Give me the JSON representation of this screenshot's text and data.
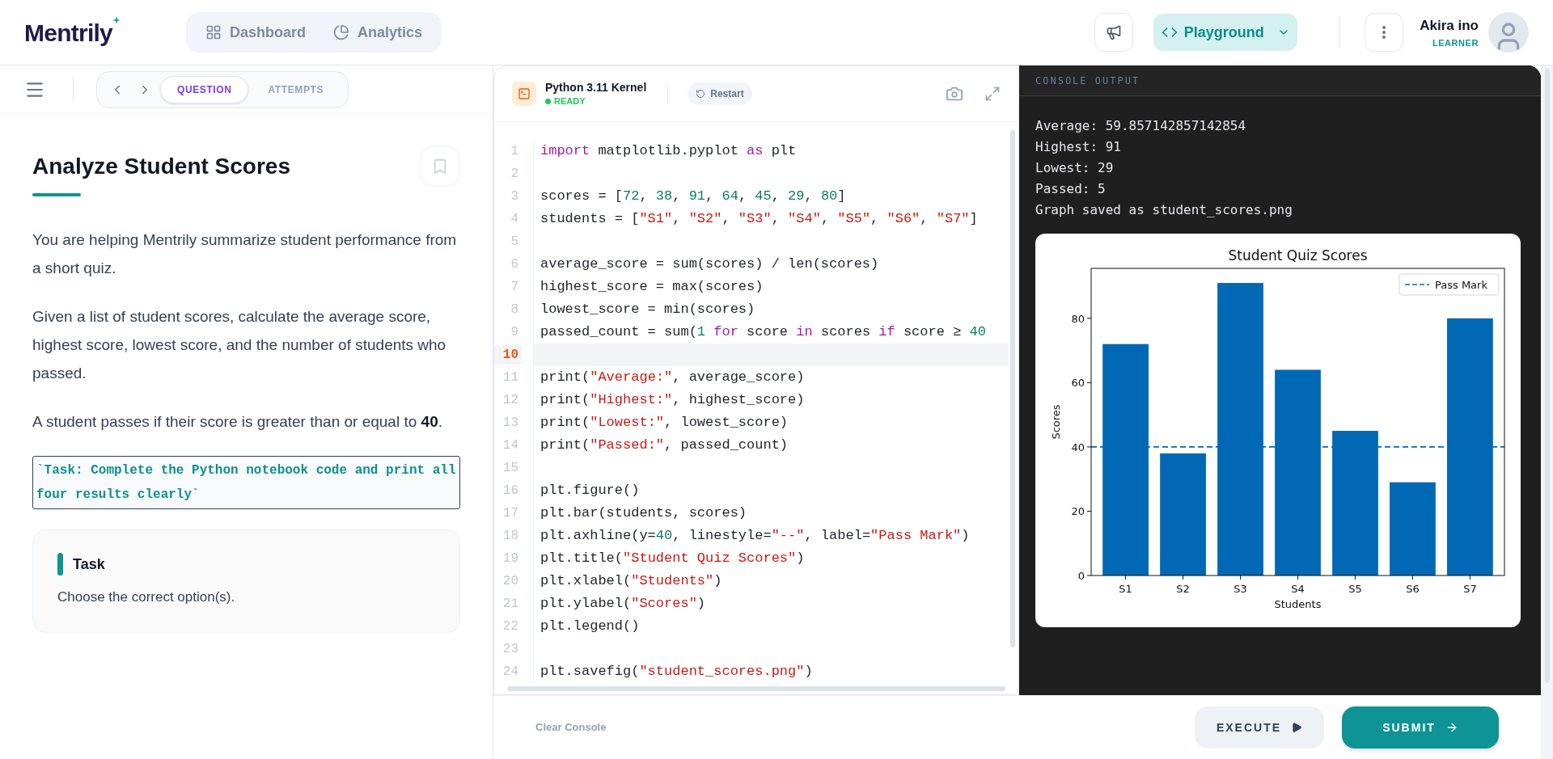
{
  "header": {
    "logo": "Mentrily",
    "nav": [
      {
        "label": "Dashboard",
        "selected": false
      },
      {
        "label": "Analytics",
        "selected": false
      }
    ],
    "playground_button": "Playground",
    "user": {
      "name": "Akira ino",
      "role": "LEARNER"
    }
  },
  "question_toolbar": {
    "tabs": [
      {
        "label": "QUESTION",
        "selected": true
      },
      {
        "label": "ATTEMPTS",
        "selected": false
      }
    ]
  },
  "question": {
    "title": "Analyze Student Scores",
    "paragraphs": [
      "You are helping Mentrily summarize student performance from a short quiz.",
      "Given a list of student scores, calculate the average score, highest score, lowest score, and the number of students who passed.",
      "A student passes if their score is greater than or equal to **40**."
    ],
    "code_note": "`Task: Complete the Python notebook code and print all four results clearly`",
    "task_card": {
      "title": "Task",
      "text": "Choose the correct option(s)."
    }
  },
  "editor": {
    "kernel": "Python 3.11 Kernel",
    "status": "READY",
    "restart_button": "Restart",
    "lines": [
      {
        "number": "1",
        "selected": false,
        "tokens": [
          {
            "kind": "keyword",
            "text": "import"
          },
          {
            "kind": "plain",
            "text": " matplotlib.pyplot "
          },
          {
            "kind": "keyword",
            "text": "as"
          },
          {
            "kind": "plain",
            "text": " plt"
          }
        ]
      },
      {
        "number": "2",
        "selected": false
      },
      {
        "number": "3",
        "selected": false,
        "tokens": [
          {
            "kind": "plain",
            "text": "scores = ["
          },
          {
            "kind": "number",
            "text": "72"
          },
          {
            "kind": "plain",
            "text": ", "
          },
          {
            "kind": "number",
            "text": "38"
          },
          {
            "kind": "plain",
            "text": ", "
          },
          {
            "kind": "number",
            "text": "91"
          },
          {
            "kind": "plain",
            "text": ", "
          },
          {
            "kind": "number",
            "text": "64"
          },
          {
            "kind": "plain",
            "text": ", "
          },
          {
            "kind": "number",
            "text": "45"
          },
          {
            "kind": "plain",
            "text": ", "
          },
          {
            "kind": "number",
            "text": "29"
          },
          {
            "kind": "plain",
            "text": ", "
          },
          {
            "kind": "number",
            "text": "80"
          },
          {
            "kind": "plain",
            "text": "]"
          }
        ]
      },
      {
        "number": "4",
        "selected": false,
        "tokens": [
          {
            "kind": "plain",
            "text": "students = ["
          },
          {
            "kind": "string",
            "text": "\"S1\""
          },
          {
            "kind": "plain",
            "text": ", "
          },
          {
            "kind": "string",
            "text": "\"S2\""
          },
          {
            "kind": "plain",
            "text": ", "
          },
          {
            "kind": "string",
            "text": "\"S3\""
          },
          {
            "kind": "plain",
            "text": ", "
          },
          {
            "kind": "string",
            "text": "\"S4\""
          },
          {
            "kind": "plain",
            "text": ", "
          },
          {
            "kind": "string",
            "text": "\"S5\""
          },
          {
            "kind": "plain",
            "text": ", "
          },
          {
            "kind": "string",
            "text": "\"S6\""
          },
          {
            "kind": "plain",
            "text": ", "
          },
          {
            "kind": "string",
            "text": "\"S7\""
          },
          {
            "kind": "plain",
            "text": "]"
          }
        ]
      },
      {
        "number": "5",
        "selected": false
      },
      {
        "number": "6",
        "selected": false,
        "tokens": [
          {
            "kind": "plain",
            "text": "average_score = sum(scores) / len(scores)"
          }
        ]
      },
      {
        "number": "7",
        "selected": false,
        "tokens": [
          {
            "kind": "plain",
            "text": "highest_score = max(scores)"
          }
        ]
      },
      {
        "number": "8",
        "selected": false,
        "tokens": [
          {
            "kind": "plain",
            "text": "lowest_score = min(scores)"
          }
        ]
      },
      {
        "number": "9",
        "selected": false,
        "tokens": [
          {
            "kind": "plain",
            "text": "passed_count = sum("
          },
          {
            "kind": "number",
            "text": "1"
          },
          {
            "kind": "keyword",
            "text": " for"
          },
          {
            "kind": "plain",
            "text": " score "
          },
          {
            "kind": "keyword",
            "text": "in"
          },
          {
            "kind": "plain",
            "text": " scores "
          },
          {
            "kind": "keyword",
            "text": "if"
          },
          {
            "kind": "plain",
            "text": " score ≥ "
          },
          {
            "kind": "number",
            "text": "40"
          }
        ]
      },
      {
        "number": "10",
        "selected": true
      },
      {
        "number": "11",
        "selected": false,
        "tokens": [
          {
            "kind": "plain",
            "text": "print("
          },
          {
            "kind": "string",
            "text": "\"Average:\""
          },
          {
            "kind": "plain",
            "text": ", average_score)"
          }
        ]
      },
      {
        "number": "12",
        "selected": false,
        "tokens": [
          {
            "kind": "plain",
            "text": "print("
          },
          {
            "kind": "string",
            "text": "\"Highest:\""
          },
          {
            "kind": "plain",
            "text": ", highest_score)"
          }
        ]
      },
      {
        "number": "13",
        "selected": false,
        "tokens": [
          {
            "kind": "plain",
            "text": "print("
          },
          {
            "kind": "string",
            "text": "\"Lowest:\""
          },
          {
            "kind": "plain",
            "text": ", lowest_score)"
          }
        ]
      },
      {
        "number": "14",
        "selected": false,
        "tokens": [
          {
            "kind": "plain",
            "text": "print("
          },
          {
            "kind": "string",
            "text": "\"Passed:\""
          },
          {
            "kind": "plain",
            "text": ", passed_count)"
          }
        ]
      },
      {
        "number": "15",
        "selected": false
      },
      {
        "number": "16",
        "selected": false,
        "tokens": [
          {
            "kind": "plain",
            "text": "plt.figure()"
          }
        ]
      },
      {
        "number": "17",
        "selected": false,
        "tokens": [
          {
            "kind": "plain",
            "text": "plt.bar(students, scores)"
          }
        ]
      },
      {
        "number": "18",
        "selected": false,
        "tokens": [
          {
            "kind": "plain",
            "text": "plt.axhline(y="
          },
          {
            "kind": "number",
            "text": "40"
          },
          {
            "kind": "plain",
            "text": ", linestyle="
          },
          {
            "kind": "string",
            "text": "\"--\""
          },
          {
            "kind": "plain",
            "text": ", label="
          },
          {
            "kind": "string",
            "text": "\"Pass Mark\""
          },
          {
            "kind": "plain",
            "text": ")"
          }
        ]
      },
      {
        "number": "19",
        "selected": false,
        "tokens": [
          {
            "kind": "plain",
            "text": "plt.title("
          },
          {
            "kind": "string",
            "text": "\"Student Quiz Scores\""
          },
          {
            "kind": "plain",
            "text": ")"
          }
        ]
      },
      {
        "number": "20",
        "selected": false,
        "tokens": [
          {
            "kind": "plain",
            "text": "plt.xlabel("
          },
          {
            "kind": "string",
            "text": "\"Students\""
          },
          {
            "kind": "plain",
            "text": ")"
          }
        ]
      },
      {
        "number": "21",
        "selected": false,
        "tokens": [
          {
            "kind": "plain",
            "text": "plt.ylabel("
          },
          {
            "kind": "string",
            "text": "\"Scores\""
          },
          {
            "kind": "plain",
            "text": ")"
          }
        ]
      },
      {
        "number": "22",
        "selected": false,
        "tokens": [
          {
            "kind": "plain",
            "text": "plt.legend()"
          }
        ]
      },
      {
        "number": "23",
        "selected": false
      },
      {
        "number": "24",
        "selected": false,
        "tokens": [
          {
            "kind": "plain",
            "text": "plt.savefig("
          },
          {
            "kind": "string",
            "text": "\"student_scores.png\""
          },
          {
            "kind": "plain",
            "text": ")"
          }
        ]
      }
    ]
  },
  "console": {
    "title": "CONSOLE OUTPUT",
    "output": [
      "Average: 59.857142857142854",
      "Highest: 91",
      "Lowest: 29",
      "Passed: 5",
      "Graph saved as student_scores.png"
    ],
    "chart_data": {
      "type": "bar",
      "title": "Student Quiz Scores",
      "xlabel": "Students",
      "ylabel": "Scores",
      "categories": [
        "S1",
        "S2",
        "S3",
        "S4",
        "S5",
        "S6",
        "S7"
      ],
      "values": [
        72,
        38,
        91,
        64,
        45,
        29,
        80
      ],
      "ylim": [
        0,
        95.55
      ],
      "yticks": [
        0,
        20,
        40,
        60,
        80
      ],
      "ref_lines": [
        {
          "axis": "y",
          "value": 40,
          "label": "Pass Mark"
        }
      ]
    }
  },
  "footer": {
    "clear_button": "Clear Console",
    "execute_button": "EXECUTE",
    "submit_button": "SUBMIT"
  }
}
